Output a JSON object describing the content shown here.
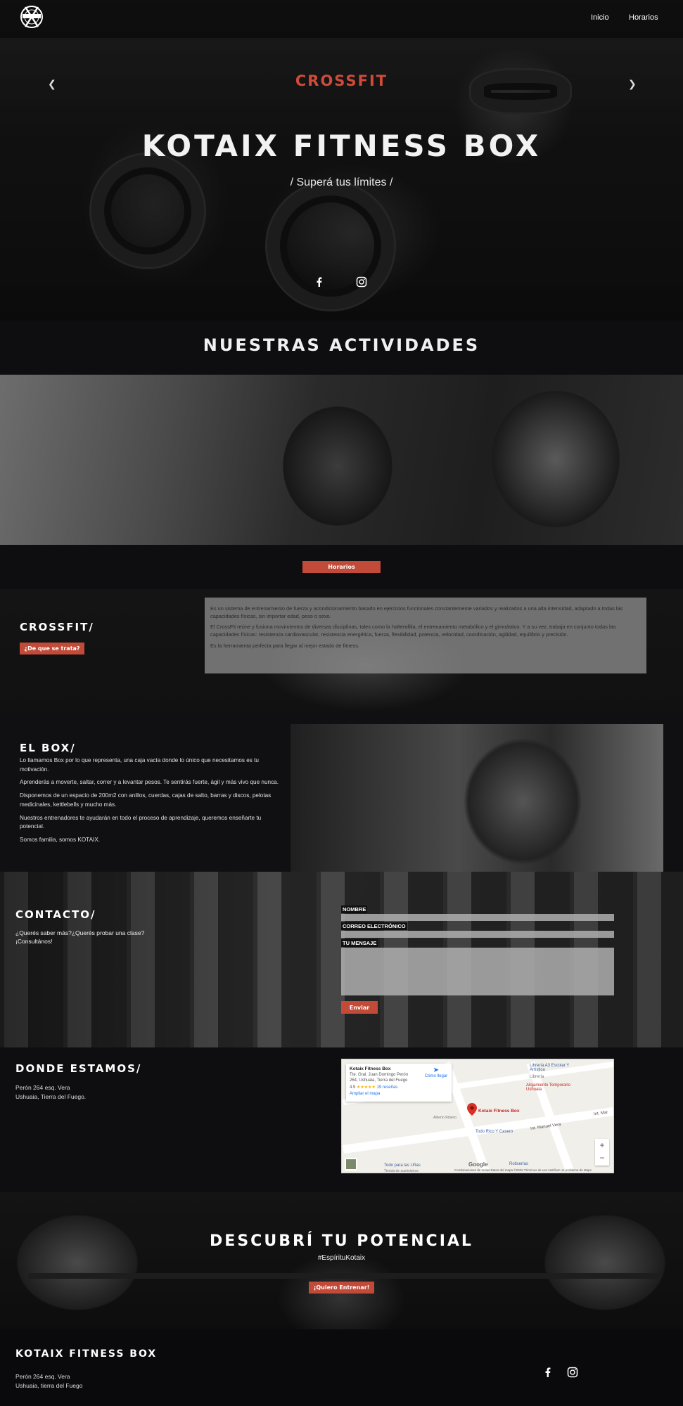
{
  "nav": {
    "links": [
      "Inicio",
      "Horarios"
    ]
  },
  "hero": {
    "title": "KOTAIX FITNESS BOX",
    "subtitle": "/ Superá tus límites /"
  },
  "activities": {
    "heading": "NUESTRAS ACTIVIDADES",
    "slide_title": "CROSSFIT",
    "button": "Horarios"
  },
  "crossfit": {
    "title": "CROSSFIT",
    "slash": "/",
    "button": "¿De que se trata?",
    "paragraphs": [
      "Es un sistema de entrenamiento de fuerza y acondicionamiento basado en ejercicios funcionales constantemente variados y realizados a una alta intensidad, adaptado a todas las capacidades físicas, sin importar edad, peso o sexo.",
      "El CrossFit reúne y fusiona movimientos de diversas disciplinas, tales como la halterofilia, el entrenamiento metabólico y el gimnástico. Y a su vez, trabaja en conjunto todas las capacidades físicas: resistencia cardiovascular, resistencia energética, fuerza, flexibilidad, potencia, velocidad, coordinación, agilidad, equilibrio y precisión.",
      "Es la herramienta perfecta para llegar al mejor estado de fitness."
    ]
  },
  "box": {
    "title": "EL BOX",
    "slash": "/",
    "paragraphs": [
      "Lo llamamos Box por lo que representa, una caja vacía donde lo único que necesitamos es tu motivación.",
      "Aprenderás a moverte, saltar, correr y a levantar pesos. Te sentirás fuerte, ágil y más vivo que nunca.",
      "Disponemos de un espacio de 200m2 con anillos, cuerdas, cajas de salto, barras y discos, pelotas medicinales, kettlebells y mucho más.",
      "Nuestros entrenadores te ayudarán en todo el proceso de aprendizaje, queremos enseñarte tu potencial.",
      "Somos familia, somos KOTAIX."
    ]
  },
  "contact": {
    "title": "CONTACTO",
    "slash": "/",
    "lines": [
      "¿Querés saber más?¿Querés probar una clase?",
      "¡Consultános!"
    ],
    "fields": [
      "NOMBRE",
      "CORREO ELECTRÓNICO",
      "TU MENSAJE"
    ],
    "submit": "Enviar"
  },
  "location": {
    "title": "DONDE ESTAMOS",
    "slash": "/",
    "address": [
      "Perón 264 esq. Vera",
      "Ushuaia, Tierra del Fuego."
    ],
    "map": {
      "place_name": "Kotaix Fitness Box",
      "place_address": "Tte. Gral. Juan Domingo Perón 264, Ushuaia, Tierra del Fuego",
      "rating": "4.9",
      "stars": "★★★★★",
      "reviews": "19 reseñas",
      "directions": "Cómo llegar",
      "enlarge": "Ampliar el mapa",
      "marker_label": "Kotaix Fitness Box",
      "labels": [
        "Librería A3 Escolar Y Artística",
        "Librería",
        "Alojamiento Temporario Ushuaia",
        "Todo Rico Y Casero",
        "Int. Manuel Vera",
        "Int. Mar",
        "Rotiserías",
        "Todo para las Uñas",
        "Tienda de suministros",
        "Alberto Ribeiro"
      ],
      "zoom_in": "+",
      "zoom_out": "−",
      "google": "Google",
      "footer_links": "Combinaciones de teclas   Datos del mapa ©2022   Términos de uso   Notificar un problema de Maps"
    }
  },
  "cta": {
    "title": "DESCUBRÍ TU POTENCIAL",
    "hashtag": "#EspírituKotaix",
    "button": "¡Quiero Entrenar!"
  },
  "footer": {
    "title": "KOTAIX FITNESS BOX",
    "address": [
      "Perón 264 esq. Vera",
      "Ushuaia, tierra del Fuego"
    ]
  },
  "colors": {
    "accent": "#c14a38",
    "background": "#0d0d0f"
  },
  "icons": [
    "facebook-icon",
    "instagram-icon",
    "chevron-left-icon",
    "chevron-right-icon",
    "map-pin-icon"
  ]
}
